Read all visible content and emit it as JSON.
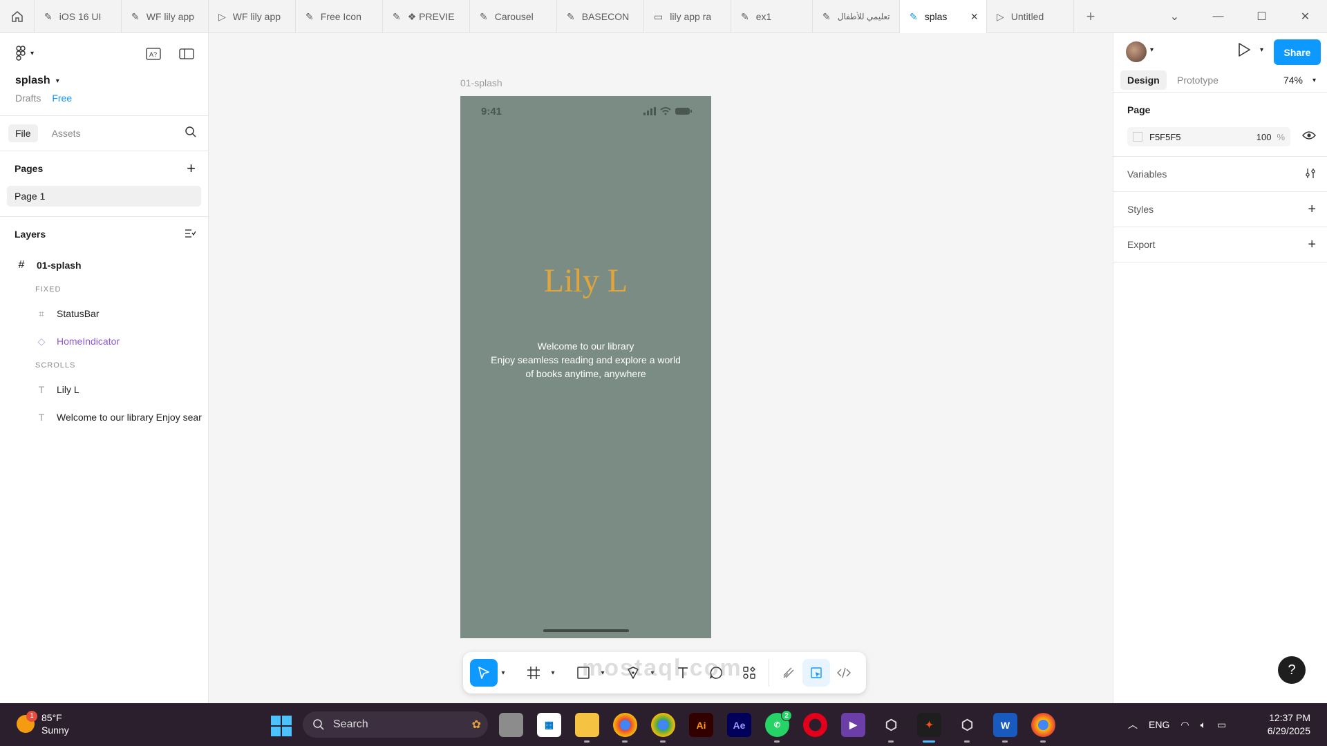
{
  "tabs": [
    {
      "label": "iOS 16 UI",
      "icon": "figma-file-icon"
    },
    {
      "label": "WF lily app",
      "icon": "figma-file-icon"
    },
    {
      "label": "WF lily app",
      "icon": "prototype-play-icon"
    },
    {
      "label": "Free Icon",
      "icon": "figma-file-icon"
    },
    {
      "label": "❖ PREVIE",
      "icon": "figma-file-icon"
    },
    {
      "label": "Carousel",
      "icon": "figma-file-icon"
    },
    {
      "label": "BASECON",
      "icon": "figma-file-icon"
    },
    {
      "label": "lily app ra",
      "icon": "figjam-file-icon"
    },
    {
      "label": "ex1",
      "icon": "figma-file-icon"
    },
    {
      "label": "تعليمي للأطفال",
      "icon": "figma-file-icon"
    },
    {
      "label": "splas",
      "icon": "figma-file-icon",
      "active": true
    },
    {
      "label": "Untitled",
      "icon": "prototype-play-icon"
    }
  ],
  "left": {
    "file_name": "splash",
    "drafts": "Drafts",
    "plan": "Free",
    "file_tab": "File",
    "assets_tab": "Assets",
    "pages_title": "Pages",
    "page_1": "Page 1",
    "layers_title": "Layers",
    "frame_layer": "01-splash",
    "fixed_label": "FIXED",
    "status_bar_layer": "StatusBar",
    "home_indicator_layer": "HomeIndicator",
    "scrolls_label": "SCROLLS",
    "text_layer_1": "Lily L",
    "text_layer_2": "Welcome to our library Enjoy sear"
  },
  "canvas": {
    "frame_label": "01-splash",
    "status_time": "9:41",
    "brand": "Lily L",
    "welcome_line1": "Welcome to our library",
    "welcome_line2": "Enjoy seamless reading and explore a world",
    "welcome_line3": "of books anytime, anywhere",
    "frame_color": "#7a8c83",
    "brand_color": "#e0a63c"
  },
  "right": {
    "share": "Share",
    "design_tab": "Design",
    "prototype_tab": "Prototype",
    "zoom": "74%",
    "page_title": "Page",
    "page_color": "F5F5F5",
    "page_opacity": "100",
    "page_opacity_unit": "%",
    "variables": "Variables",
    "styles": "Styles",
    "export": "Export",
    "help": "?"
  },
  "taskbar": {
    "temperature": "85°F",
    "condition": "Sunny",
    "weather_badge": "1",
    "search": "Search",
    "language": "ENG",
    "time": "12:37 PM",
    "date": "6/29/2025",
    "whatsapp_badge": "2"
  },
  "watermark": "mostaql.com"
}
